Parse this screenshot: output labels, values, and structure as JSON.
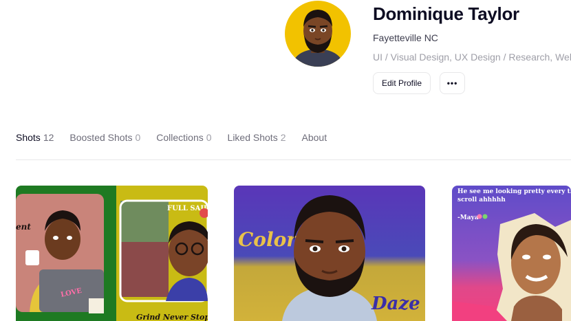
{
  "profile": {
    "name": "Dominique Taylor",
    "location": "Fayetteville NC",
    "skills": "UI / Visual Design, UX Design / Research, Web D",
    "edit_button": "Edit Profile",
    "more_button": "•••",
    "avatar_icon": "avatar-portrait-icon"
  },
  "tabs": [
    {
      "label": "Shots",
      "count": "12"
    },
    {
      "label": "Boosted Shots",
      "count": "0"
    },
    {
      "label": "Collections",
      "count": "0"
    },
    {
      "label": "Liked Shots",
      "count": "2"
    },
    {
      "label": "About",
      "count": ""
    }
  ],
  "shots": [
    {
      "label_1": "ent",
      "label_2": "FULL SAIL",
      "label_3": "Grind Never Stops",
      "label_4": "LOVE"
    },
    {
      "label_1": "Color",
      "label_2": "Daze"
    },
    {
      "label_1": "He see me looking pretty every time he",
      "label_2": "scroll ahhhhh",
      "label_3": "-Maya"
    }
  ],
  "colors": {
    "brand_text": "#0d0c22",
    "muted_text": "#6e6d7a",
    "border": "#e7e7e9",
    "avatar_bg": "#f2c200"
  }
}
